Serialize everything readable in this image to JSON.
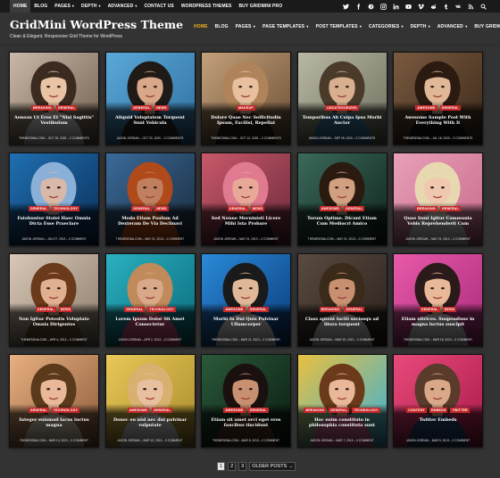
{
  "topbar": {
    "items": [
      {
        "label": "HOME",
        "active": true,
        "caret": false
      },
      {
        "label": "BLOG",
        "active": false,
        "caret": false
      },
      {
        "label": "PAGES",
        "active": false,
        "caret": true
      },
      {
        "label": "DEPTH",
        "active": false,
        "caret": true
      },
      {
        "label": "ADVANCED",
        "active": false,
        "caret": true
      },
      {
        "label": "CONTACT US",
        "active": false,
        "caret": false
      },
      {
        "label": "WORDPRESS THEMES",
        "active": false,
        "caret": false
      },
      {
        "label": "BUY GRIDMINI PRO",
        "active": false,
        "caret": false
      }
    ],
    "social_icons": [
      "twitter-icon",
      "facebook-icon",
      "pinterest-icon",
      "instagram-icon",
      "linkedin-icon",
      "youtube-icon",
      "vimeo-icon",
      "reddit-icon",
      "tumblr-icon",
      "vk-icon",
      "rss-icon",
      "search-icon"
    ]
  },
  "header": {
    "site_title": "GridMini WordPress Theme",
    "tagline": "Clean & Elegant, Responsive Grid Theme for WordPress"
  },
  "mainnav": {
    "items": [
      {
        "label": "HOME",
        "active": true,
        "caret": false
      },
      {
        "label": "BLOG",
        "active": false,
        "caret": false
      },
      {
        "label": "PAGES",
        "active": false,
        "caret": true
      },
      {
        "label": "PAGE TEMPLATES",
        "active": false,
        "caret": true
      },
      {
        "label": "POST TEMPLATES",
        "active": false,
        "caret": true
      },
      {
        "label": "CATEGORIES",
        "active": false,
        "caret": true
      },
      {
        "label": "DEPTH",
        "active": false,
        "caret": true
      },
      {
        "label": "ADVANCED",
        "active": false,
        "caret": true
      },
      {
        "label": "BUY GRIDMINI PRO",
        "active": false,
        "caret": false
      }
    ]
  },
  "colors": {
    "accent": "#f5b51e",
    "category_red": "#c62828",
    "background": "#333333"
  },
  "posts": [
    {
      "cats": [
        "BREAKING",
        "GENERAL"
      ],
      "title": "Aenean Ut Eros Et \"Nisl Sagittis\" Vestibulum",
      "author": "THEMESDNA.COM",
      "date": "OCT 25, 2020",
      "comments": "2 COMMENTS",
      "bg": [
        "#c9b8a8",
        "#6f5c4c"
      ],
      "skin": "#e8c4a4",
      "hair": "#3a2a20",
      "shirt": "#eeeeee"
    },
    {
      "cats": [
        "GENERAL",
        "NEWS"
      ],
      "title": "Aliquid Voluptatem Torquent Sunt Vehicula",
      "author": "JASON JORDAN",
      "date": "OCT 20, 2020",
      "comments": "0 COMMENTS",
      "bg": [
        "#5aa8d8",
        "#2f6f9f"
      ],
      "skin": "#d8a888",
      "hair": "#1f1a16",
      "shirt": "#2a2a2a"
    },
    {
      "cats": [
        "MAKEUP"
      ],
      "title": "Dolore Quae Nec Sollicitudin Ipsum, Facilisi, Repellat",
      "author": "THEMESDNA.COM",
      "date": "OCT 12, 2020",
      "comments": "2 COMMENTS",
      "bg": [
        "#c3a07a",
        "#6a4e34"
      ],
      "skin": "#e8c0a0",
      "hair": "#b0845a",
      "shirt": "#2e2218"
    },
    {
      "cats": [
        "UNCATEGORIZED"
      ],
      "title": "Temporibus Ab Culpa Ipsa Morbi Auctor",
      "author": "JASON JORDAN",
      "date": "SEP 25, 2020",
      "comments": "0 COMMENTS",
      "bg": [
        "#b8b8a4",
        "#6e6e5e"
      ],
      "skin": "#d8b090",
      "hair": "#4a3a2a",
      "shirt": "#3f7fa8"
    },
    {
      "cats": [
        "AWESOME",
        "GENERAL"
      ],
      "title": "Awesome Sample Post With Everything With It",
      "author": "THEMESDNA.COM",
      "date": "JUL 18, 2020",
      "comments": "2 COMMENTS",
      "bg": [
        "#7a5a40",
        "#3a2818"
      ],
      "skin": "#e0b898",
      "hair": "#2a1a10",
      "shirt": "#1a1a1a"
    },
    {
      "cats": [
        "GENERAL",
        "TECHNOLOGY"
      ],
      "title": "Fatebuntur Stolei Haec Omnia Dicta Esse Praeclare",
      "author": "JASON JORDAN",
      "date": "JUN 27, 2013",
      "comments": "0 COMMENT",
      "bg": [
        "#1f6fb0",
        "#0b2f5a"
      ],
      "skin": "#d8b8a8",
      "hair": "#8ab0d8",
      "shirt": "#1a3a6a"
    },
    {
      "cats": [
        "GENERAL",
        "NEWS"
      ],
      "title": "Modo Etiam Paulum Ad Dexteram De Via Declinavi",
      "author": "THEMESDNA.COM",
      "date": "MAY 21, 2013",
      "comments": "0 COMMENT",
      "bg": [
        "#3a6a9a",
        "#1a2a3a"
      ],
      "skin": "#c08060",
      "hair": "#b04a1a",
      "shirt": "#d85a1a"
    },
    {
      "cats": [
        "GENERAL",
        "NEWS"
      ],
      "title": "Sed Nonne Merninisti Licere Mihi Ista Probare",
      "author": "JASON JORDAN",
      "date": "MAY 21, 2013",
      "comments": "0 COMMENT",
      "bg": [
        "#c8586a",
        "#6a2a3a"
      ],
      "skin": "#e8a898",
      "hair": "#e07a90",
      "shirt": "#2a1a2a"
    },
    {
      "cats": [
        "AWESOME",
        "GENERAL"
      ],
      "title": "Torum Optime. Dicunt Etiam Cum Mediocri Amico",
      "author": "THEMESDNA.COM",
      "date": "MAY 21, 2013",
      "comments": "0 COMMENT",
      "bg": [
        "#3a6a5a",
        "#10241c"
      ],
      "skin": "#d0a080",
      "hair": "#2a1a10",
      "shirt": "#2a4a3a"
    },
    {
      "cats": [
        "BREAKING",
        "GENERAL"
      ],
      "title": "Quae Sunt Igitur Communia Vobis Reprehenderit Cum",
      "author": "JASON JORDAN",
      "date": "MAY 21, 2013",
      "comments": "0 COMMENT",
      "bg": [
        "#e8a0b8",
        "#c86a8a"
      ],
      "skin": "#f0c8b0",
      "hair": "#e8d8b0",
      "shirt": "#e8e8e8"
    },
    {
      "cats": [
        "GENERAL",
        "NEWS"
      ],
      "title": "Non Igitur Potestis Voluptate Omnia Dirigentes",
      "author": "THEMESDNA.COM",
      "date": "APR 4, 2013",
      "comments": "0 COMMENT",
      "bg": [
        "#d8c8b8",
        "#8a7a6a"
      ],
      "skin": "#e0b090",
      "hair": "#6a3a1a",
      "shirt": "#7a5a3a"
    },
    {
      "cats": [
        "GENERAL",
        "TECHNOLOGY"
      ],
      "title": "Lorem Ipsum Dolor Sit Amet Consectetur",
      "author": "JASON JORDAN",
      "date": "APR 2, 2013",
      "comments": "0 COMMENT",
      "bg": [
        "#2ab0c0",
        "#0a6a7a"
      ],
      "skin": "#d8a888",
      "hair": "#c08a5a",
      "shirt": "#e85a8a"
    },
    {
      "cats": [
        "AWESOME",
        "GENERAL"
      ],
      "title": "Morbi In Dui Quis Pulvinar Ullamcorper",
      "author": "THEMESDNA.COM",
      "date": "MAR 21, 2013",
      "comments": "0 COMMENT",
      "bg": [
        "#2a8ad8",
        "#0a3a7a"
      ],
      "skin": "#e0b898",
      "hair": "#1a1a1a",
      "shirt": "#f0f0f0"
    },
    {
      "cats": [
        "BREAKING",
        "GENERAL"
      ],
      "title": "Class aptent taciti sociosqu ad litora torquent",
      "author": "JASON JORDAN",
      "date": "MAR 19, 2013",
      "comments": "0 COMMENT",
      "bg": [
        "#5a4a40",
        "#2a201a"
      ],
      "skin": "#c89070",
      "hair": "#3a2a1a",
      "shirt": "#e8e8e8"
    },
    {
      "cats": [
        "GENERAL",
        "NEWS"
      ],
      "title": "Etiam ultrices. Suspendisse in magna luctus suscipit",
      "author": "THEMESDNA.COM",
      "date": "MAR 18, 2013",
      "comments": "0 COMMENT",
      "bg": [
        "#e85aa8",
        "#a82a7a"
      ],
      "skin": "#e8b898",
      "hair": "#2a1a1a",
      "shirt": "#e8e8e8"
    },
    {
      "cats": [
        "GENERAL",
        "TECHNOLOGY"
      ],
      "title": "Integer euismod lacus luctus magna",
      "author": "THEMESDNA.COM",
      "date": "MAR 13, 2013",
      "comments": "0 COMMENT",
      "bg": [
        "#e8b080",
        "#8a5a3a"
      ],
      "skin": "#e8b898",
      "hair": "#5a3a1a",
      "shirt": "#f0e0c8"
    },
    {
      "cats": [
        "AWESOME",
        "GENERAL"
      ],
      "title": "Donec eu nisl nec dui pulvinar vulputate",
      "author": "JASON JORDAN",
      "date": "MAR 13, 2013",
      "comments": "0 COMMENT",
      "bg": [
        "#e8c858",
        "#a88a2a"
      ],
      "skin": "#e8c0a0",
      "hair": "#d8b070",
      "shirt": "#e8e8e8"
    },
    {
      "cats": [
        "AWESOME",
        "GENERAL"
      ],
      "title": "Etiam sit amet orci eget eros faucibus tincidunt",
      "author": "THEMESDNA.COM",
      "date": "MAR 8, 2013",
      "comments": "0 COMMENT",
      "bg": [
        "#2a5a3a",
        "#0a1a10"
      ],
      "skin": "#c89070",
      "hair": "#1a1010",
      "shirt": "#5a3a2a"
    },
    {
      "cats": [
        "BREAKING",
        "GENERAL",
        "TECHNOLOGY"
      ],
      "title": "Hoc enim constituto in philosophia constituta sunt",
      "author": "JASON JORDAN",
      "date": "MAR 7, 2013",
      "comments": "0 COMMENT",
      "bg": [
        "#e8c040",
        "#3ab0d8"
      ],
      "skin": "#e8b898",
      "hair": "#6a3a1a",
      "shirt": "#e86aa8"
    },
    {
      "cats": [
        "CONTENT",
        "EMBEDS",
        "TWITTER"
      ],
      "title": "Twitter Embeds",
      "author": "JASON JORDAN",
      "date": "MAR 5, 2013",
      "comments": "0 COMMENT",
      "bg": [
        "#e84a7a",
        "#a81a4a"
      ],
      "skin": "#d8a888",
      "hair": "#5a3a2a",
      "shirt": "#2a4a7a"
    }
  ],
  "pagination": {
    "pages": [
      "1",
      "2",
      "3"
    ],
    "current": "1",
    "older_label": "OLDER POSTS"
  }
}
